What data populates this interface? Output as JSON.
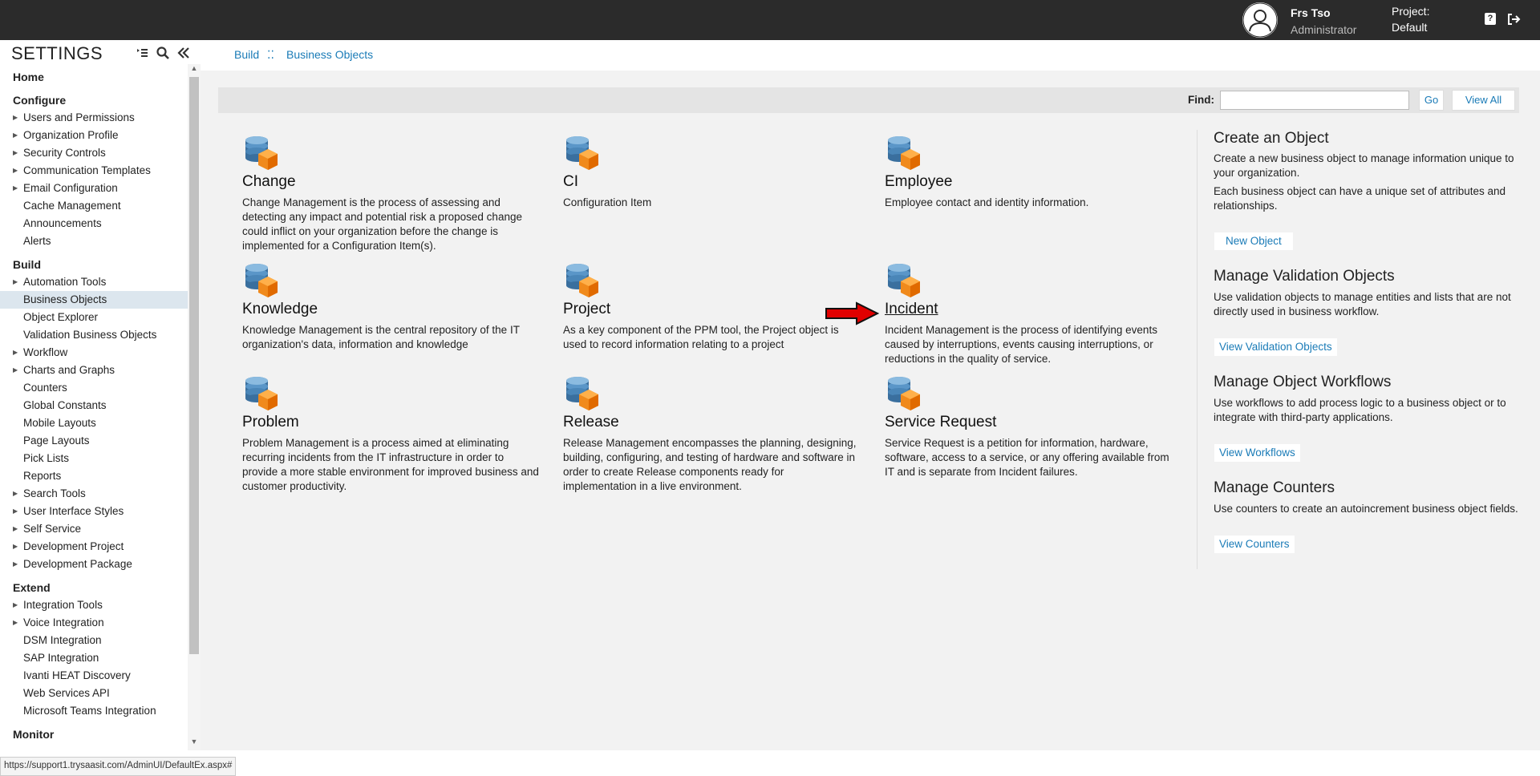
{
  "topbar": {
    "user_name": "Frs Tso",
    "user_role": "Administrator",
    "project_label": "Project:",
    "project_value": "Default",
    "icons": [
      "user-avatar-icon",
      "help-icon",
      "logout-icon"
    ]
  },
  "sidebar": {
    "title": "SETTINGS",
    "home": "Home",
    "sections": [
      {
        "title": "Configure",
        "items": [
          {
            "label": "Users and Permissions",
            "expandable": true
          },
          {
            "label": "Organization Profile",
            "expandable": true
          },
          {
            "label": "Security Controls",
            "expandable": true
          },
          {
            "label": "Communication Templates",
            "expandable": true
          },
          {
            "label": "Email Configuration",
            "expandable": true
          },
          {
            "label": "Cache Management",
            "expandable": false
          },
          {
            "label": "Announcements",
            "expandable": false
          },
          {
            "label": "Alerts",
            "expandable": false
          }
        ]
      },
      {
        "title": "Build",
        "items": [
          {
            "label": "Automation Tools",
            "expandable": true
          },
          {
            "label": "Business Objects",
            "expandable": false,
            "selected": true
          },
          {
            "label": "Object Explorer",
            "expandable": false
          },
          {
            "label": "Validation Business Objects",
            "expandable": false
          },
          {
            "label": "Workflow",
            "expandable": true
          },
          {
            "label": "Charts and Graphs",
            "expandable": true
          },
          {
            "label": "Counters",
            "expandable": false
          },
          {
            "label": "Global Constants",
            "expandable": false
          },
          {
            "label": "Mobile Layouts",
            "expandable": false
          },
          {
            "label": "Page Layouts",
            "expandable": false
          },
          {
            "label": "Pick Lists",
            "expandable": false
          },
          {
            "label": "Reports",
            "expandable": false
          },
          {
            "label": "Search Tools",
            "expandable": true
          },
          {
            "label": "User Interface Styles",
            "expandable": true
          },
          {
            "label": "Self Service",
            "expandable": true
          },
          {
            "label": "Development Project",
            "expandable": true
          },
          {
            "label": "Development Package",
            "expandable": true
          }
        ]
      },
      {
        "title": "Extend",
        "items": [
          {
            "label": "Integration Tools",
            "expandable": true
          },
          {
            "label": "Voice Integration",
            "expandable": true
          },
          {
            "label": "DSM Integration",
            "expandable": false
          },
          {
            "label": "SAP Integration",
            "expandable": false
          },
          {
            "label": "Ivanti HEAT Discovery",
            "expandable": false
          },
          {
            "label": "Web Services API",
            "expandable": false
          },
          {
            "label": "Microsoft Teams Integration",
            "expandable": false
          }
        ]
      },
      {
        "title": "Monitor",
        "items": []
      }
    ]
  },
  "breadcrumb": {
    "build": "Build",
    "separator": "⁚⁚",
    "current": "Business Objects"
  },
  "find": {
    "label": "Find:",
    "value": "",
    "go_label": "Go",
    "view_all_label": "View All"
  },
  "objects": [
    {
      "name": "Change",
      "description": "Change Management is the process of assessing and detecting any impact and potential risk a proposed change could inflict on your organization before the change is implemented for a Configuration Item(s)."
    },
    {
      "name": "CI",
      "description": "Configuration Item"
    },
    {
      "name": "Employee",
      "description": "Employee contact and identity information."
    },
    {
      "name": "Knowledge",
      "description": "Knowledge Management is the central repository of the IT organization's data, information and knowledge"
    },
    {
      "name": "Project",
      "description": "As a key component of the PPM tool, the Project object is used to record information relating to a project"
    },
    {
      "name": "Incident",
      "description": "Incident Management is the process of identifying events caused by interruptions, events causing interruptions, or reductions in the quality of service."
    },
    {
      "name": "Problem",
      "description": "Problem Management is a process aimed at eliminating recurring incidents from the IT infrastructure in order to provide a more stable environment for improved business and customer productivity."
    },
    {
      "name": "Release",
      "description": "Release Management encompasses the planning, designing, building, configuring, and testing of hardware and software in order to create Release components ready for implementation in a live environment."
    },
    {
      "name": "Service Request",
      "description": "Service Request is a petition for information, hardware, software, access to a service, or any offering available from IT and is separate from Incident failures."
    }
  ],
  "right_panel": {
    "create": {
      "title": "Create an Object",
      "text1": "Create a new business object to manage information unique to your organization.",
      "text2": "Each business object can have a unique set of attributes and relationships.",
      "button": "New Object"
    },
    "validation": {
      "title": "Manage Validation Objects",
      "text": "Use validation objects to manage entities and lists that are not directly used in business workflow.",
      "button": "View Validation Objects"
    },
    "workflows": {
      "title": "Manage Object Workflows",
      "text": "Use workflows to add process logic to a business object or to integrate with third-party applications.",
      "button": "View Workflows"
    },
    "counters": {
      "title": "Manage Counters",
      "text": "Use counters to create an autoincrement business object fields.",
      "button": "View Counters"
    }
  },
  "status_bar": "https://support1.trysaasit.com/AdminUI/DefaultEx.aspx#",
  "colors": {
    "topbar": "#2b2b2b",
    "link": "#1a7bb7",
    "selected": "#dce6ee",
    "arrow": "#e00000"
  }
}
